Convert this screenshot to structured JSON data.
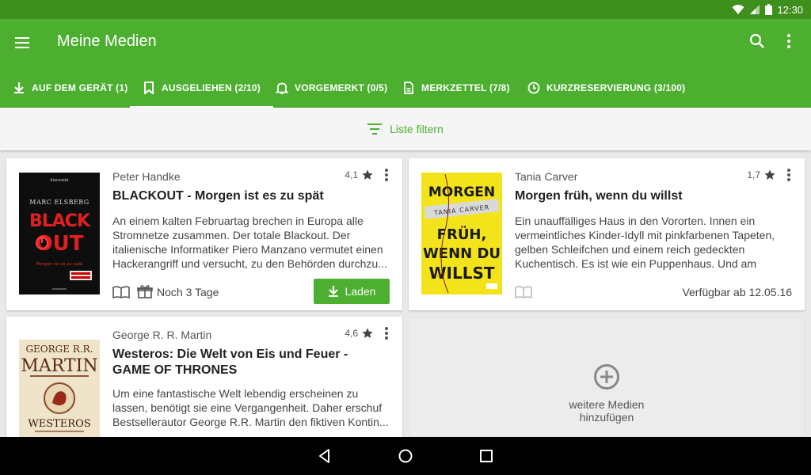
{
  "status_bar": {
    "time": "12:30"
  },
  "app_bar": {
    "title": "Meine Medien"
  },
  "tabs": [
    {
      "label": "AUF DEM GERÄT (1)",
      "icon": "download-icon",
      "active": false
    },
    {
      "label": "AUSGELIEHEN (2/10)",
      "icon": "bookmark-icon",
      "active": true
    },
    {
      "label": "VORGEMERKT (0/5)",
      "icon": "bell-icon",
      "active": false
    },
    {
      "label": "MERKZETTEL (7/8)",
      "icon": "document-icon",
      "active": false
    },
    {
      "label": "KURZRESERVIERUNG (3/100)",
      "icon": "clock-icon",
      "active": false
    }
  ],
  "filter": {
    "label": "Liste filtern"
  },
  "books": [
    {
      "author": "Peter Handke",
      "title": "BLACKOUT - Morgen ist es zu spät",
      "rating": "4,1",
      "description": "An einem kalten Februartag brechen in Europa alle Stromnetze zusammen. Der totale Blackout. Der italienische Informatiker Piero Manzano vermutet einen Hackerangriff und versucht, zu den Behörden durchzu...",
      "loan_remaining": "Noch 3 Tage",
      "load_button": "Laden",
      "cover": {
        "publisher": "blanvalet",
        "author": "MARC ELSBERG",
        "line1": "BLACK",
        "line2": "OUT",
        "subtitle": "Morgen ist es zu spät"
      }
    },
    {
      "author": "Tania Carver",
      "title": "Morgen früh, wenn du willst",
      "rating": "1,7",
      "description": "Ein unauffälliges Haus in den Vororten. Innen ein vermeintliches Kinder-Idyll mit pinkfarbenen Tapeten, gelben Schleifchen und einem reich gedeckten Kuchentisch. Es ist wie ein Puppenhaus. Und am Tisch...",
      "availability": "Verfügbar ab 12.05.16",
      "cover": {
        "line1": "MORGEN",
        "author": "TANIA CARVER",
        "line2": "FRÜH,",
        "line3": "WENN DU",
        "line4": "WILLST"
      }
    },
    {
      "author": "George R. R. Martin",
      "title": "Westeros: Die Welt von Eis und Feuer - GAME OF THRONES",
      "rating": "4,6",
      "description": "Um eine fantastische Welt lebendig erscheinen zu lassen, benötigt sie eine Vergangenheit. Daher erschuf Bestsellerautor George R.R. Martin den fiktiven Kontin...",
      "cover": {
        "line1": "GEORGE R.R.",
        "line2": "MARTIN",
        "line3": "WESTEROS"
      }
    }
  ],
  "add_card": {
    "label": "weitere Medien hinzufügen"
  },
  "colors": {
    "primary": "#4caf30",
    "primary_dark": "#3f8f1d",
    "accent": "#4caf30"
  }
}
